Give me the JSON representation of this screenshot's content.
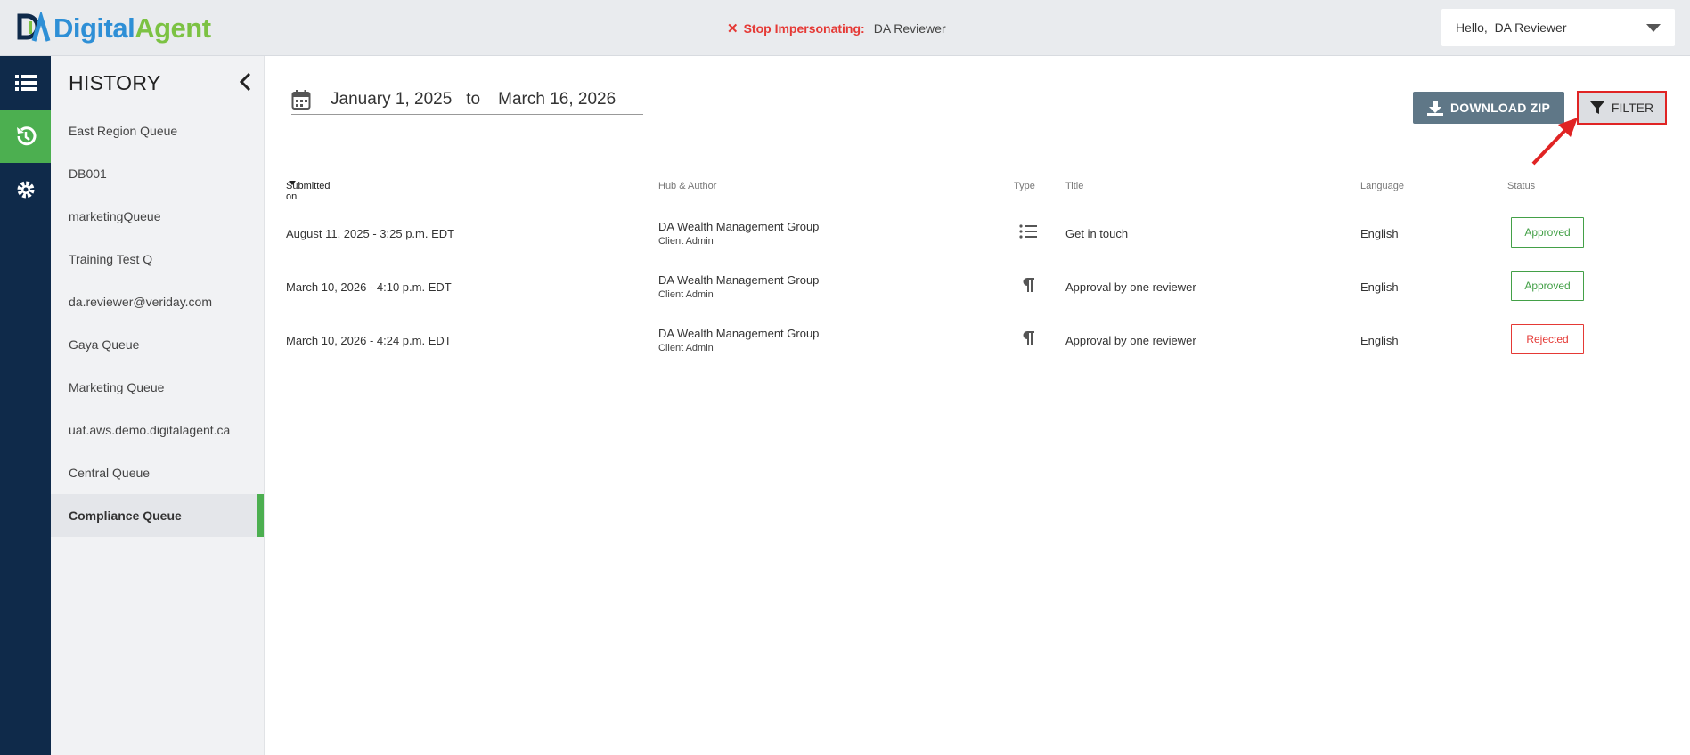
{
  "brand": {
    "name_part1": "Digital",
    "name_part2": "Agent",
    "blue": "#2e8fd6",
    "green": "#7cc243"
  },
  "impersonation": {
    "stop_label": "Stop Impersonating:",
    "user": "DA Reviewer"
  },
  "user_menu": {
    "greeting": "Hello,  DA Reviewer"
  },
  "rail": {
    "items": [
      "list-icon",
      "history-icon",
      "gear-icon"
    ],
    "active": "history-icon"
  },
  "sidebar": {
    "title": "HISTORY",
    "items": [
      {
        "label": "East Region Queue"
      },
      {
        "label": "DB001"
      },
      {
        "label": "marketingQueue"
      },
      {
        "label": "Training Test Q"
      },
      {
        "label": "da.reviewer@veriday.com"
      },
      {
        "label": "Gaya Queue"
      },
      {
        "label": "Marketing Queue"
      },
      {
        "label": "uat.aws.demo.digitalagent.ca"
      },
      {
        "label": "Central Queue"
      },
      {
        "label": "Compliance Queue"
      }
    ],
    "active_index": 9
  },
  "date_range": {
    "from": "January 1, 2025",
    "to_label": "to",
    "to": "March 16, 2026"
  },
  "toolbar": {
    "download_label": "DOWNLOAD ZIP",
    "filter_label": "FILTER"
  },
  "table": {
    "columns": {
      "submitted": "Submitted on",
      "hub": "Hub & Author",
      "type": "Type",
      "title": "Title",
      "language": "Language",
      "status": "Status"
    },
    "rows": [
      {
        "submitted": "August 11, 2025 - 3:25 p.m. EDT",
        "hub": "DA Wealth Management Group",
        "author": "Client Admin",
        "type_icon": "list-icon",
        "title": "Get in touch",
        "language": "English",
        "status": "Approved"
      },
      {
        "submitted": "March 10, 2026 - 4:10 p.m. EDT",
        "hub": "DA Wealth Management Group",
        "author": "Client Admin",
        "type_icon": "paragraph-icon",
        "title": "Approval by one reviewer",
        "language": "English",
        "status": "Approved"
      },
      {
        "submitted": "March 10, 2026 - 4:24 p.m. EDT",
        "hub": "DA Wealth Management Group",
        "author": "Client Admin",
        "type_icon": "paragraph-icon",
        "title": "Approval by one reviewer",
        "language": "English",
        "status": "Rejected"
      }
    ]
  },
  "colors": {
    "rail": "#0f2a4a",
    "active_green": "#4caf50",
    "approved": "#43a047",
    "rejected": "#e53935",
    "download_btn": "#5f7787"
  }
}
